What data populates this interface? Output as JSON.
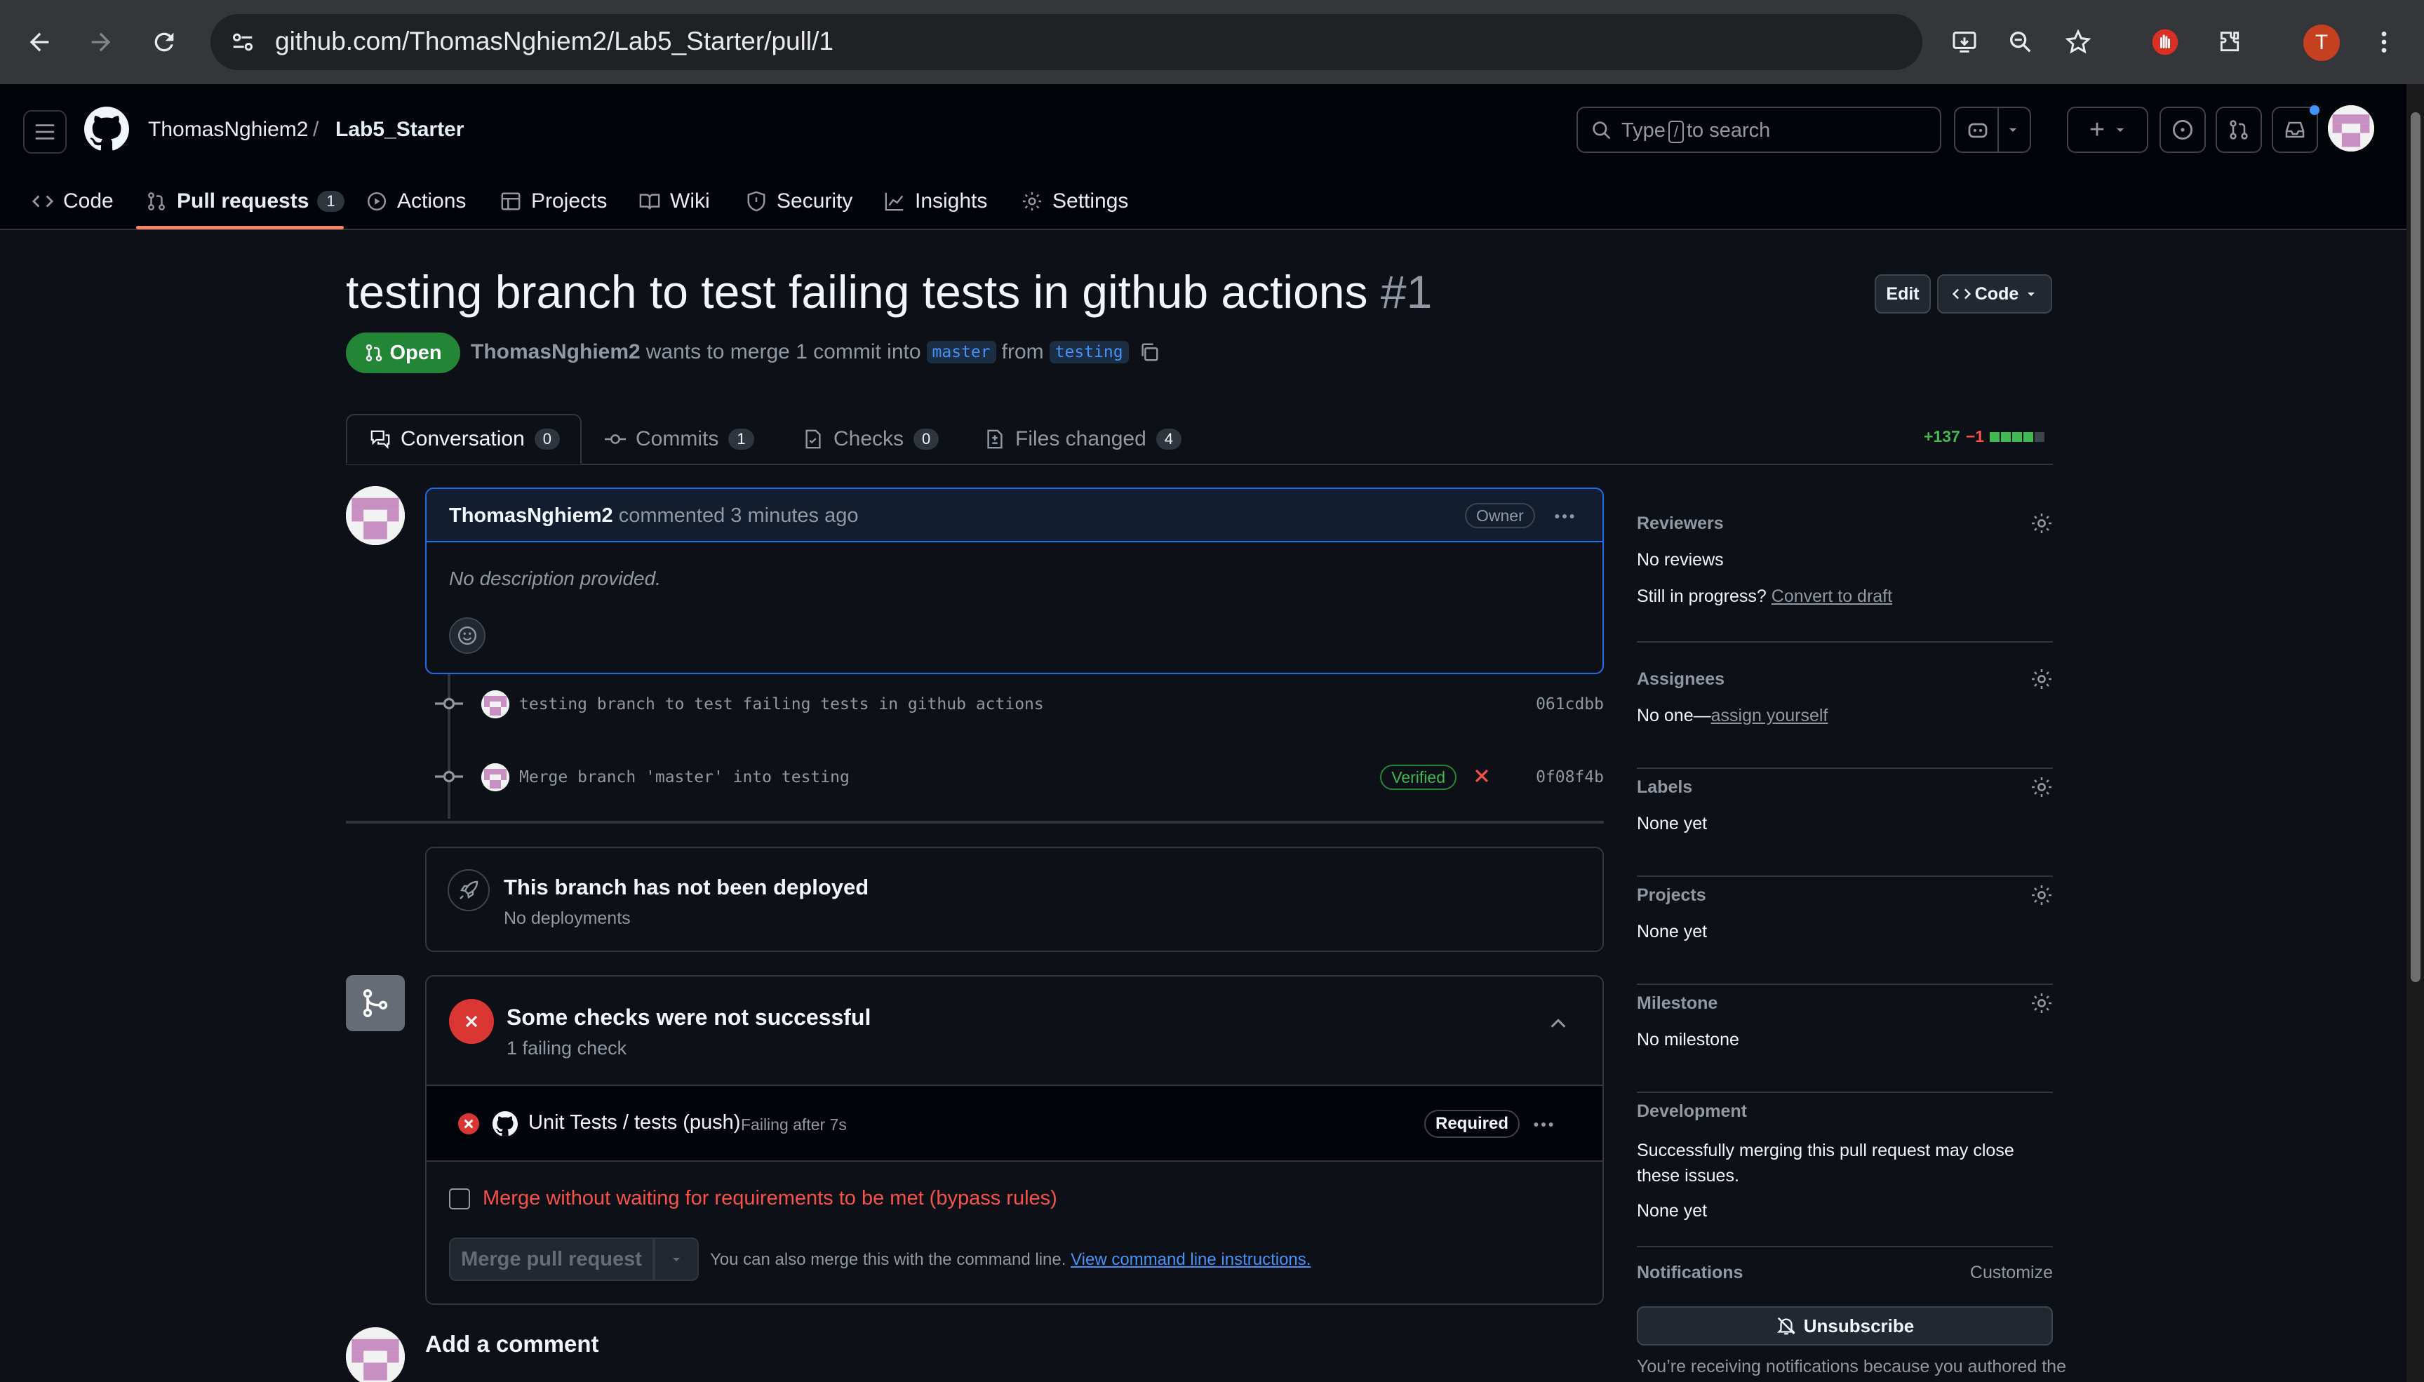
{
  "browser": {
    "url": "github.com/ThomasNghiem2/Lab5_Starter/pull/1",
    "profile_initial": "T"
  },
  "header": {
    "owner": "ThomasNghiem2",
    "separator": "/",
    "repo": "Lab5_Starter",
    "search_prefix": "Type",
    "search_key": "/",
    "search_suffix": "to search",
    "plus": "+"
  },
  "repo_nav": {
    "code": "Code",
    "pull_requests": "Pull requests",
    "pull_requests_count": "1",
    "actions": "Actions",
    "projects": "Projects",
    "wiki": "Wiki",
    "security": "Security",
    "insights": "Insights",
    "settings": "Settings"
  },
  "pr": {
    "title": "testing branch to test failing tests in github actions",
    "number": "#1",
    "edit_label": "Edit",
    "code_label": "Code",
    "state": "Open",
    "author": "ThomasNghiem2",
    "meta_text": "wants to merge 1 commit into",
    "base_branch": "master",
    "from_text": "from",
    "head_branch": "testing"
  },
  "tabs": {
    "conversation": "Conversation",
    "conversation_count": "0",
    "commits": "Commits",
    "commits_count": "1",
    "checks": "Checks",
    "checks_count": "0",
    "files": "Files changed",
    "files_count": "4",
    "additions": "+137",
    "deletions": "−1"
  },
  "comment": {
    "author": "ThomasNghiem2",
    "action": "commented 3 minutes ago",
    "badge": "Owner",
    "body": "No description provided."
  },
  "commits": [
    {
      "message": "testing branch to test failing tests in github actions",
      "sha": "061cdbb"
    },
    {
      "message": "Merge branch 'master' into testing",
      "sha": "0f08f4b",
      "verified": "Verified"
    }
  ],
  "deploy": {
    "title": "This branch has not been deployed",
    "subtitle": "No deployments"
  },
  "checks": {
    "title": "Some checks were not successful",
    "subtitle": "1 failing check",
    "check_name": "Unit Tests / tests (push)",
    "check_status": "Failing after 7s",
    "required": "Required",
    "bypass_label": "Merge without waiting for requirements to be met (bypass rules)",
    "merge_button": "Merge pull request",
    "cli_text": "You can also merge this with the command line.",
    "cli_link": "View command line instructions."
  },
  "add_comment": "Add a comment",
  "sidebar": {
    "reviewers_h": "Reviewers",
    "reviewers_v": "No reviews",
    "in_progress": "Still in progress?",
    "convert_draft": "Convert to draft",
    "assignees_h": "Assignees",
    "assignees_v": "No one—",
    "assign_self": "assign yourself",
    "labels_h": "Labels",
    "labels_v": "None yet",
    "projects_h": "Projects",
    "projects_v": "None yet",
    "milestone_h": "Milestone",
    "milestone_v": "No milestone",
    "development_h": "Development",
    "development_note": "Successfully merging this pull request may close these issues.",
    "development_v": "None yet",
    "notifications_h": "Notifications",
    "customize": "Customize",
    "unsubscribe": "Unsubscribe",
    "notif_note": "You’re receiving notifications because you authored the"
  },
  "colors": {
    "open_green": "#238636",
    "fail_red": "#da3633",
    "link_blue": "#4493f8",
    "accent_orange": "#f78166"
  }
}
